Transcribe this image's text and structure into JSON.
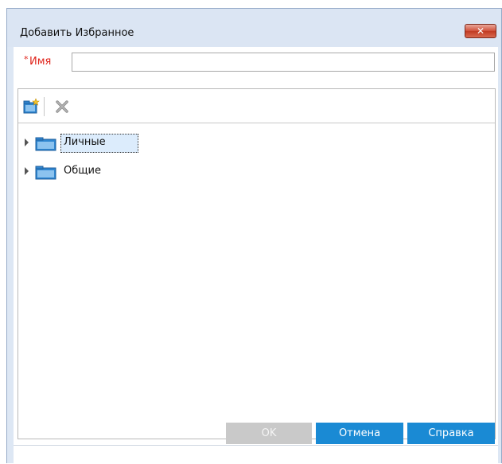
{
  "window": {
    "title": "Добавить Избранное",
    "close_label": "✕"
  },
  "form": {
    "required_marker": "*",
    "name_label": "Имя",
    "name_value": ""
  },
  "toolbar": {
    "new_folder_icon": "new-folder-icon",
    "delete_icon": "delete-icon"
  },
  "tree": {
    "nodes": [
      {
        "label": "Личные",
        "selected": true,
        "expanded": false
      },
      {
        "label": "Общие",
        "selected": false,
        "expanded": false
      }
    ]
  },
  "buttons": {
    "ok": "OK",
    "cancel": "Отмена",
    "help": "Справка"
  },
  "colors": {
    "accent": "#1a8ad4",
    "required": "#e0241b",
    "disabled": "#c9c9c9",
    "selection": "#dcecfc"
  }
}
